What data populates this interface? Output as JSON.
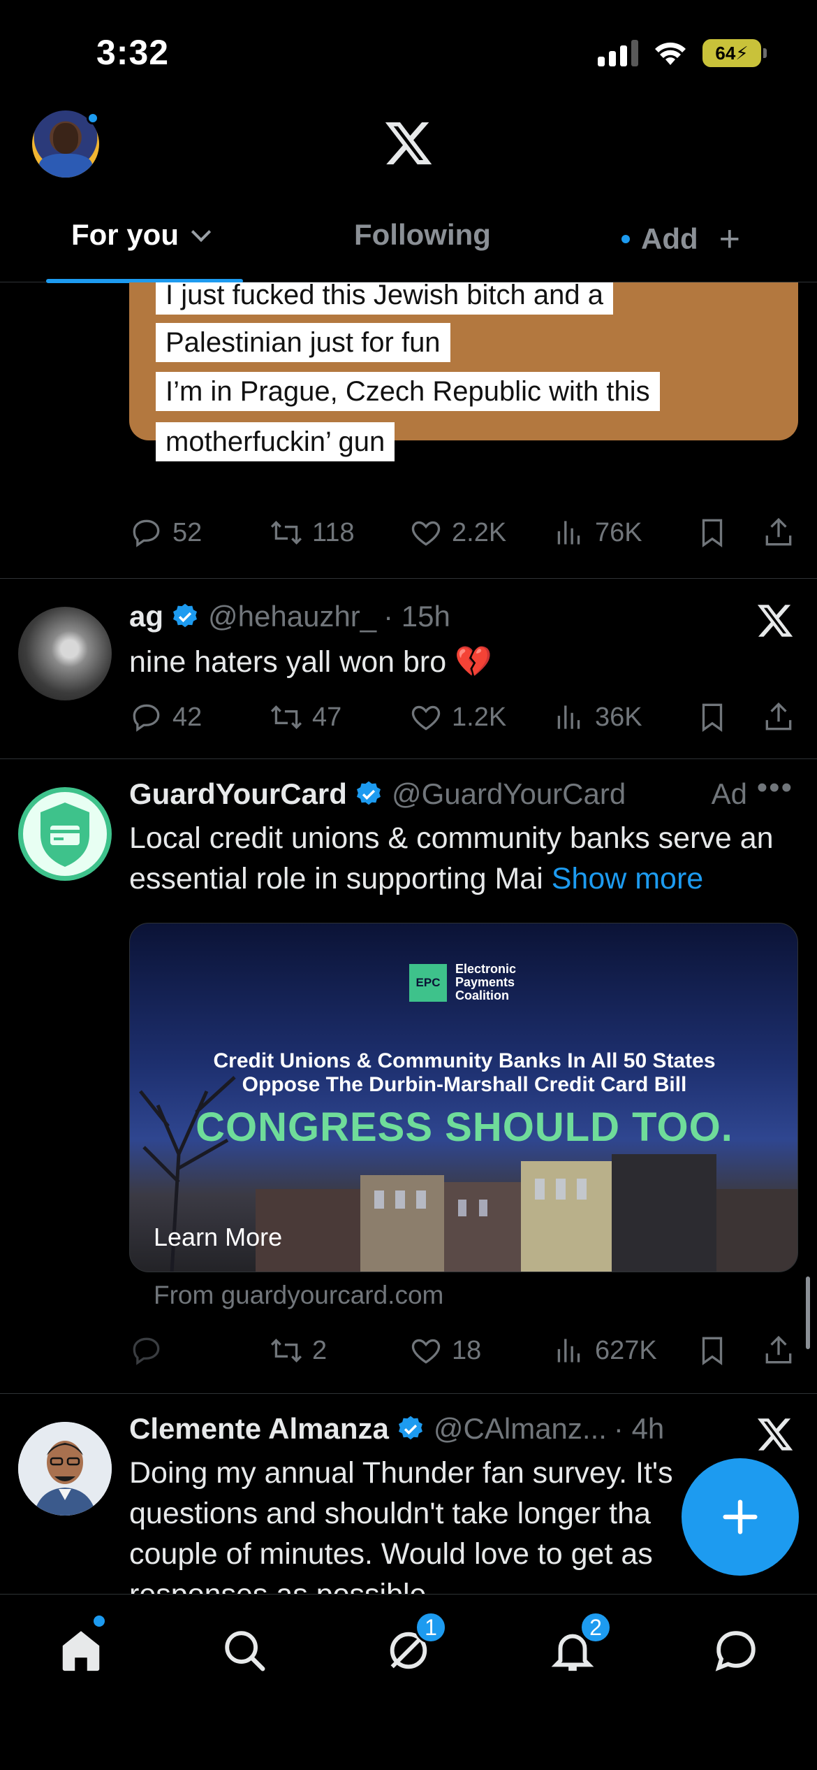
{
  "status_bar": {
    "time": "3:32",
    "battery": "64"
  },
  "header": {
    "logo": "x-logo",
    "tabs": [
      {
        "label": "For you",
        "active": true
      },
      {
        "label": "Following",
        "active": false
      },
      {
        "label": "Add",
        "active": false
      }
    ]
  },
  "posts": [
    {
      "meme_lines": [
        "I just fucked this Jewish bitch and a",
        "Palestinian just for fun",
        "I’m in Prague, Czech Republic with this",
        "motherfuckin’ gun"
      ],
      "stats": {
        "replies": "52",
        "reposts": "118",
        "likes": "2.2K",
        "views": "76K"
      }
    },
    {
      "name": "ag",
      "handle": "@hehauzhr_",
      "time": "· 15h",
      "text": "nine haters yall won bro 💔",
      "stats": {
        "replies": "42",
        "reposts": "47",
        "likes": "1.2K",
        "views": "36K"
      }
    },
    {
      "name": "GuardYourCard",
      "handle": "@GuardYourCard",
      "ad_label": "Ad",
      "text": "Local credit unions & community banks serve an essential role in supporting Mai",
      "show_more": "Show more",
      "card": {
        "logo_badge": "EPC",
        "logo_line1": "Electronic",
        "logo_line2": "Payments",
        "logo_line3": "Coalition",
        "headline_line1": "Credit Unions & Community Banks In All 50 States",
        "headline_line2": "Oppose The Durbin-Marshall Credit Card Bill",
        "big_text": "CONGRESS SHOULD TOO.",
        "cta": "Learn More"
      },
      "from": "From guardyourcard.com",
      "stats": {
        "replies": "",
        "reposts": "2",
        "likes": "18",
        "views": "627K"
      }
    },
    {
      "name": "Clemente Almanza",
      "handle": "@CAlmanz...",
      "time": "· 4h",
      "text_lines": [
        "Doing my annual Thunder fan survey. It's",
        "questions and shouldn't take longer tha",
        "couple of minutes. Would love to get as",
        "responses as possible"
      ]
    }
  ],
  "bottom_nav": {
    "items": [
      "home-icon",
      "search-icon",
      "grok-icon",
      "notifications-icon",
      "messages-icon"
    ],
    "grok_badge": "1",
    "notifications_badge": "2"
  },
  "colors": {
    "accent": "#1d9bf0",
    "muted": "#71767b",
    "background": "#000000"
  }
}
